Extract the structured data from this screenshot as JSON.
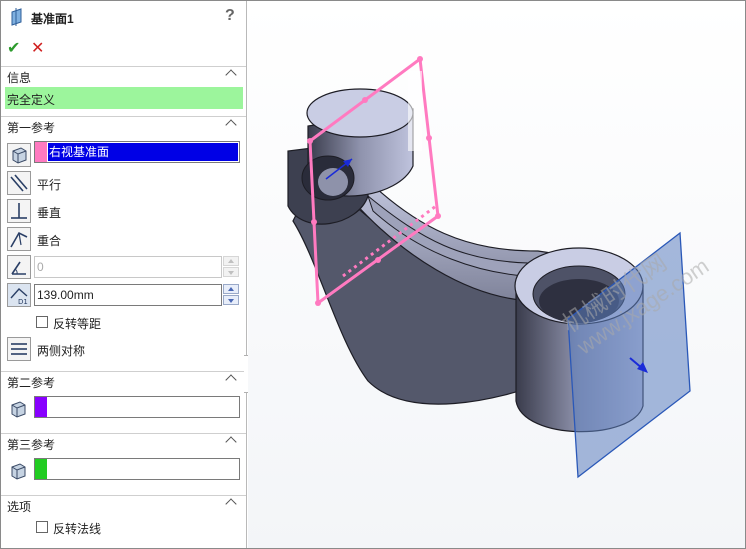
{
  "header": {
    "title": "基准面1",
    "help": "?"
  },
  "actions": {
    "ok": "✔",
    "cancel": "✕"
  },
  "info": {
    "section_label": "信息",
    "status": "完全定义"
  },
  "first_ref": {
    "section_label": "第一参考",
    "selection": "右视基准面",
    "selection_color": "#ff7ac0",
    "options": {
      "parallel": "平行",
      "perpendicular": "垂直",
      "coincident": "重合",
      "both_sides": "两侧对称"
    },
    "angle_value": "0",
    "distance_value": "139.00mm",
    "flip_offset": "反转等距"
  },
  "second_ref": {
    "section_label": "第二参考",
    "selection_color": "#8800ff"
  },
  "third_ref": {
    "section_label": "第三参考",
    "selection_color": "#22cc22"
  },
  "options": {
    "section_label": "选项",
    "flip_normal": "反转法线"
  },
  "viewport": {
    "watermark_line1": "机械时代网",
    "watermark_line2": "www.jxage.com"
  }
}
